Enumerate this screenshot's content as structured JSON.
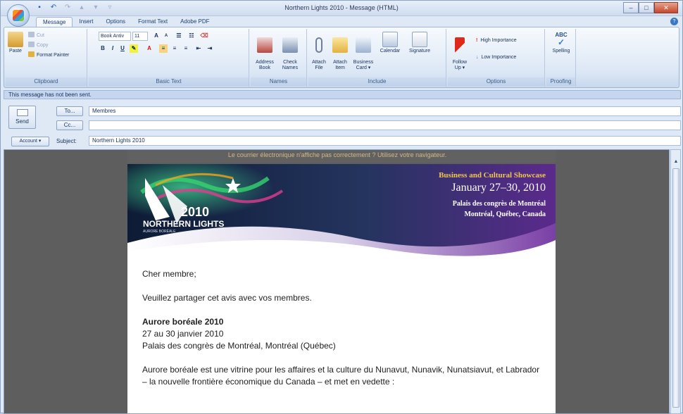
{
  "window": {
    "title": "Northern Lights 2010 - Message (HTML)",
    "controls": [
      "–",
      "□",
      "✕"
    ]
  },
  "ribbon": {
    "tabs": [
      "Message",
      "Insert",
      "Options",
      "Format Text",
      "Adobe PDF"
    ],
    "clipboard": {
      "paste": "Paste",
      "cut": "Cut",
      "copy": "Copy",
      "format_painter": "Format Painter",
      "label": "Clipboard"
    },
    "basic_text": {
      "font": "Book Antiv",
      "size": "11",
      "label": "Basic Text"
    },
    "names": {
      "address_book": "Address\nBook",
      "check_names": "Check\nNames",
      "label": "Names"
    },
    "include": {
      "attach_file": "Attach\nFile",
      "attach_item": "Attach\nItem",
      "business_card": "Business\nCard ▾",
      "calendar": "Calendar",
      "signature": "Signature",
      "label": "Include"
    },
    "options": {
      "follow_up": "Follow\nUp ▾",
      "high_importance": "High Importance",
      "low_importance": "Low Importance",
      "label": "Options"
    },
    "proofing": {
      "spelling": "Spelling",
      "label": "Proofing"
    }
  },
  "infobar": "This message has not been sent.",
  "header": {
    "send": "Send",
    "to_button": "To...",
    "to_value": "Membres",
    "cc_button": "Cc...",
    "cc_value": "",
    "account_button": "Account ▾",
    "subject_label": "Subject:",
    "subject_value": "Northern Lights 2010"
  },
  "email": {
    "notice": "Le courrier électronique n'affiche pas correctement ? Utilisez votre navigateur.",
    "banner": {
      "year": "2010",
      "brand": "NORTHERN LIGHTS",
      "brand_sub": "AURORE BORÉALE",
      "showcase": "Business and Cultural Showcase",
      "dates": "January 27–30, 2010",
      "venue": "Palais des congrès de Montréal",
      "city": "Montréal, Québec, Canada"
    },
    "greeting": "Cher membre;",
    "line1": "Veuillez partager cet avis avec vos membres.",
    "event_title": "Aurore boréale 2010",
    "event_dates": "27 au 30 janvier 2010",
    "event_place": "Palais des congrès de Montréal, Montréal (Québec)",
    "paragraph": "Aurore boréale est une vitrine pour les affaires et la culture du Nunavut, Nunavik, Nunatsiavut, et Labrador – la nouvelle frontière économique du Canada – et met en vedette :"
  },
  "colors": {
    "ribbon_bg": "#dce7f5",
    "body_bg": "#5e5e5e",
    "banner_purple": "#6a2c91",
    "notice_text": "#d4b887"
  }
}
